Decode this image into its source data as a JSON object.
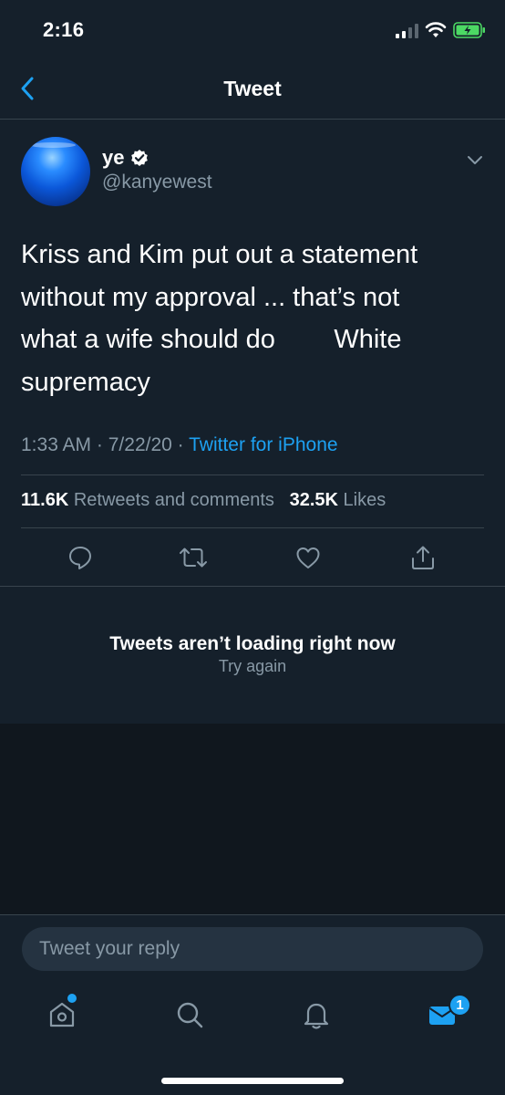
{
  "status_bar": {
    "time": "2:16"
  },
  "nav": {
    "title": "Tweet"
  },
  "tweet": {
    "display_name": "ye",
    "handle": "@kanyewest",
    "text": "Kriss and Kim put out a statement\nwithout my approval ... that’s not\nwhat a wife should do        White\nsupremacy",
    "time": "1:33 AM",
    "date": "7/22/20",
    "separator": "·",
    "source": "Twitter for iPhone",
    "retweets_count": "11.6K",
    "retweets_label": "Retweets and comments",
    "likes_count": "32.5K",
    "likes_label": "Likes"
  },
  "error": {
    "title": "Tweets aren’t loading right now",
    "action": "Try again"
  },
  "reply": {
    "placeholder": "Tweet your reply"
  },
  "tabs": {
    "messages_badge": "1"
  },
  "colors": {
    "background": "#15202b",
    "secondary_text": "#8899a6",
    "accent": "#1da1f2",
    "divider": "#38444d",
    "battery": "#4cd964"
  },
  "icons": [
    "back-chevron-icon",
    "verified-badge-icon",
    "caret-down-icon",
    "reply-icon",
    "retweet-icon",
    "like-icon",
    "share-icon",
    "home-icon",
    "search-icon",
    "notifications-icon",
    "messages-icon"
  ]
}
